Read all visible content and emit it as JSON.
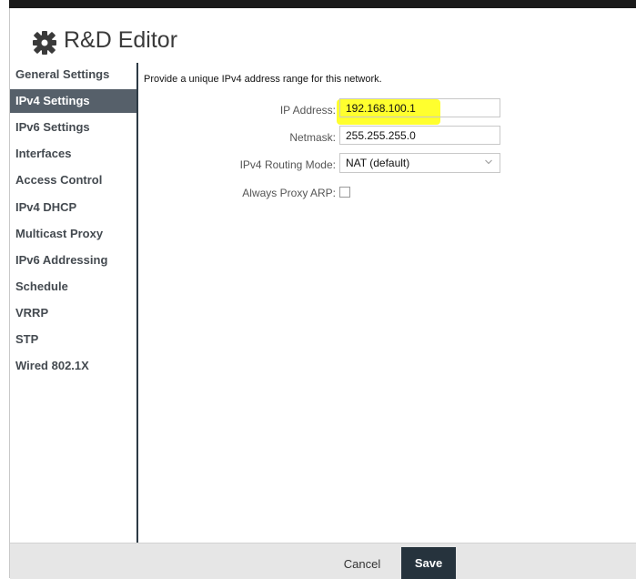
{
  "window": {
    "title": "R&D Editor",
    "title_icon": "gear-icon"
  },
  "sidebar": {
    "items": [
      {
        "label": "General Settings",
        "active": false
      },
      {
        "label": "IPv4 Settings",
        "active": true
      },
      {
        "label": "IPv6 Settings",
        "active": false
      },
      {
        "label": "Interfaces",
        "active": false
      },
      {
        "label": "Access Control",
        "active": false
      },
      {
        "label": "IPv4 DHCP",
        "active": false
      },
      {
        "label": "Multicast Proxy",
        "active": false
      },
      {
        "label": "IPv6 Addressing",
        "active": false
      },
      {
        "label": "Schedule",
        "active": false
      },
      {
        "label": "VRRP",
        "active": false
      },
      {
        "label": "STP",
        "active": false
      },
      {
        "label": "Wired 802.1X",
        "active": false
      }
    ]
  },
  "form": {
    "intro": "Provide a unique IPv4 address range for this network.",
    "ip_address": {
      "label": "IP Address:",
      "value": "192.168.100.1"
    },
    "netmask": {
      "label": "Netmask:",
      "value": "255.255.255.0"
    },
    "routing_mode": {
      "label": "IPv4 Routing Mode:",
      "value": "NAT (default)"
    },
    "proxy_arp": {
      "label": "Always Proxy ARP:",
      "checked": false
    }
  },
  "footer": {
    "cancel_label": "Cancel",
    "save_label": "Save"
  },
  "colors": {
    "active_tab": "#56606a",
    "save_button": "#26333d",
    "highlight": "#ffff2e"
  }
}
